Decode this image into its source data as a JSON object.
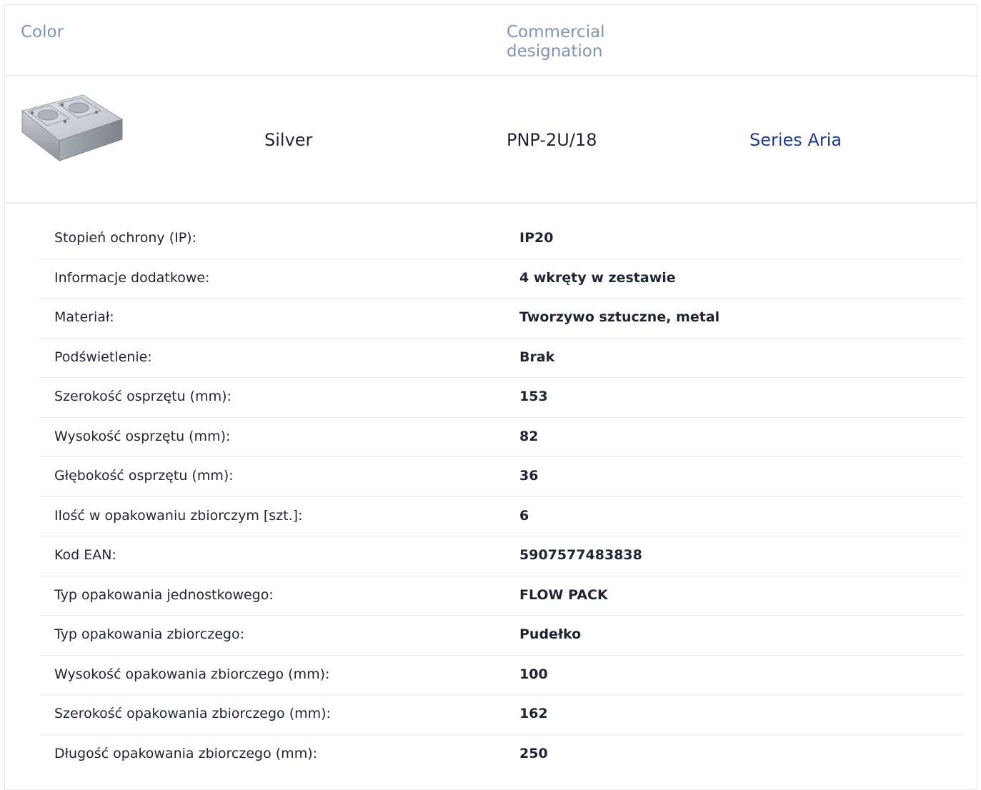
{
  "header": {
    "color_label": "Color",
    "designation_label": "Commercial designation"
  },
  "product": {
    "image_icon": "metal-double-box-icon",
    "color": "Silver",
    "code": "PNP-2U/18",
    "series": "Series Aria",
    "series_color": "#1d3c8c"
  },
  "specs": [
    {
      "label": "Stopień ochrony (IP):",
      "value": "IP20"
    },
    {
      "label": "Informacje dodatkowe:",
      "value": "4 wkręty w zestawie"
    },
    {
      "label": "Materiał:",
      "value": "Tworzywo sztuczne, metal"
    },
    {
      "label": "Podświetlenie:",
      "value": "Brak"
    },
    {
      "label": "Szerokość osprzętu (mm):",
      "value": "153"
    },
    {
      "label": "Wysokość osprzętu (mm):",
      "value": "82"
    },
    {
      "label": "Głębokość osprzętu (mm):",
      "value": "36"
    },
    {
      "label": "Ilość w opakowaniu zbiorczym [szt.]:",
      "value": "6"
    },
    {
      "label": "Kod EAN:",
      "value": "5907577483838"
    },
    {
      "label": "Typ opakowania jednostkowego:",
      "value": "FLOW PACK"
    },
    {
      "label": "Typ opakowania zbiorczego:",
      "value": "Pudełko"
    },
    {
      "label": "Wysokość opakowania zbiorczego (mm):",
      "value": "100"
    },
    {
      "label": "Szerokość opakowania zbiorczego (mm):",
      "value": "162"
    },
    {
      "label": "Długość opakowania zbiorczego (mm):",
      "value": "250"
    }
  ]
}
